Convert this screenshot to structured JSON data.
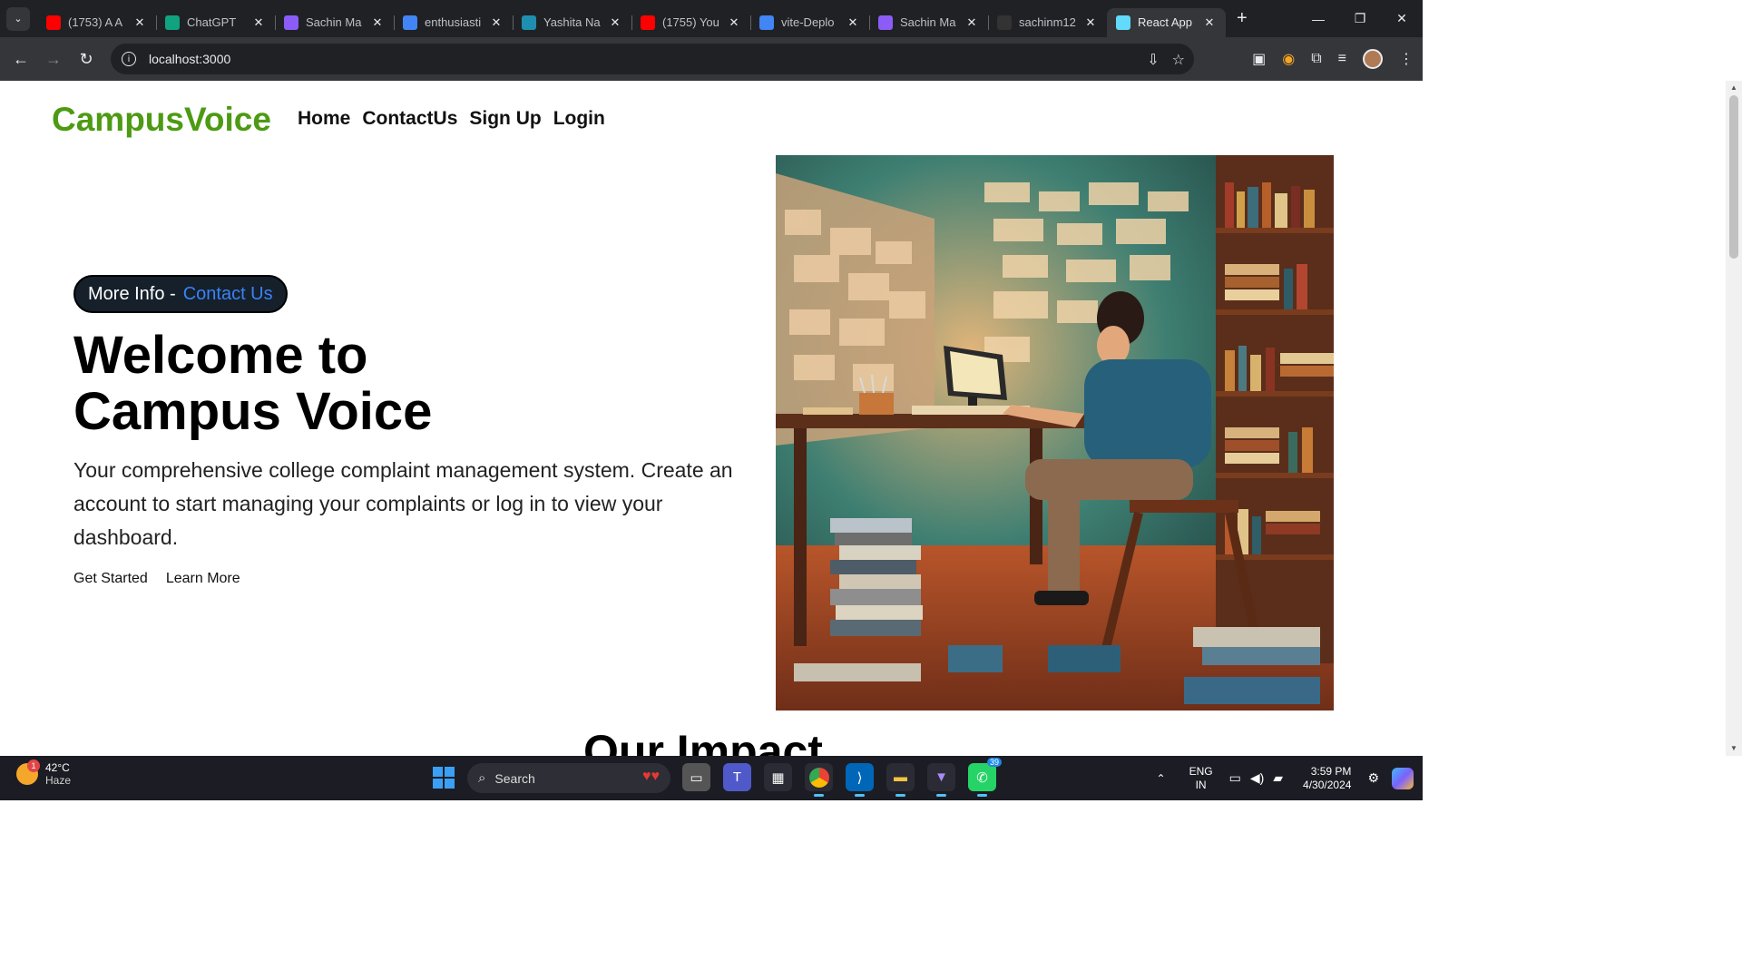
{
  "browser": {
    "tabs": [
      {
        "title": "(1753) A A",
        "favicon": "youtube-icon",
        "color": "#ff0000"
      },
      {
        "title": "ChatGPT",
        "favicon": "chatgpt-icon",
        "color": "#10a37f"
      },
      {
        "title": "Sachin Ma",
        "favicon": "vite-icon",
        "color": "#8b5cf6"
      },
      {
        "title": "enthusiasti",
        "favicon": "google-icon",
        "color": "#4285f4"
      },
      {
        "title": "Yashita Na",
        "favicon": "hexagon-icon",
        "color": "#1f8fb0"
      },
      {
        "title": "(1755) You",
        "favicon": "youtube-icon",
        "color": "#ff0000"
      },
      {
        "title": "vite-Deplo",
        "favicon": "docs-icon",
        "color": "#4285f4"
      },
      {
        "title": "Sachin Ma",
        "favicon": "vite-icon",
        "color": "#8b5cf6"
      },
      {
        "title": "sachinm12",
        "favicon": "github-icon",
        "color": "#333333"
      },
      {
        "title": "React App",
        "favicon": "react-icon",
        "color": "#61dafb",
        "active": true
      }
    ],
    "url": "localhost:3000"
  },
  "app": {
    "brand": "CampusVoice",
    "brand_color": "#4d9a13",
    "nav": [
      "Home",
      "ContactUs",
      "Sign Up",
      "Login"
    ],
    "pill": {
      "prefix": "More Info -",
      "link": "Contact Us"
    },
    "title_line1": "Welcome to",
    "title_line2": "Campus Voice",
    "description": "Your comprehensive college complaint management system. Create an account to start managing your complaints or log in to view your dashboard.",
    "cta": [
      "Get Started",
      "Learn More"
    ],
    "section_title": "Our Impact"
  },
  "taskbar": {
    "temp": "42°C",
    "weather": "Haze",
    "weather_badge": "1",
    "search": "Search",
    "whatsapp_count": "39",
    "lang1": "ENG",
    "lang2": "IN",
    "time": "3:59 PM",
    "date": "4/30/2024"
  }
}
